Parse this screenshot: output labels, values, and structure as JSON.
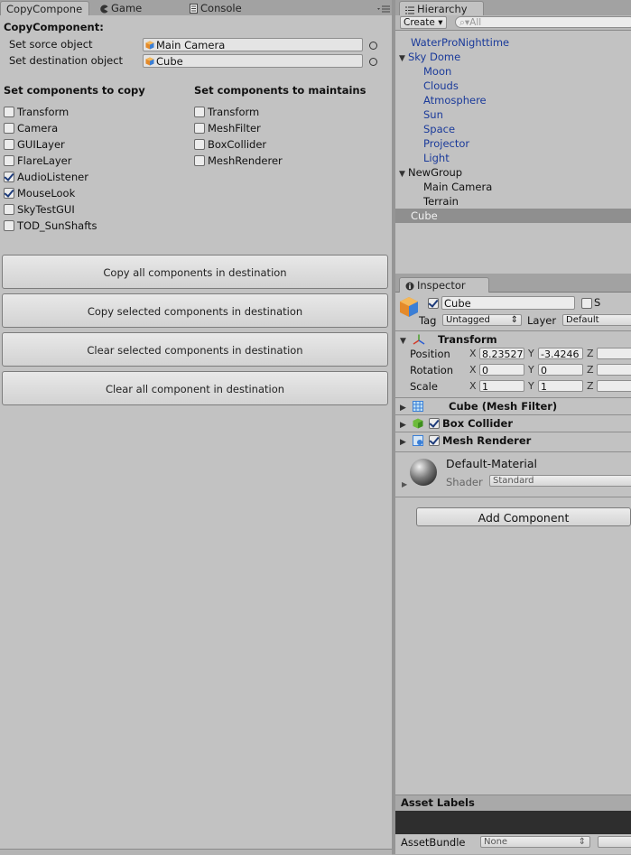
{
  "left_tabs": [
    {
      "label": "CopyCompone",
      "icon": "none",
      "active": true
    },
    {
      "label": "Game",
      "icon": "pacman-icon",
      "active": false
    },
    {
      "label": "Console",
      "icon": "console-icon",
      "active": false
    }
  ],
  "copy": {
    "header": "CopyComponent:",
    "source_label": "Set sorce object",
    "source_value": "Main Camera",
    "dest_label": "Set destination object",
    "dest_value": "Cube",
    "copy_header": "Set components to copy",
    "maintain_header": "Set components to maintains",
    "copy_list": [
      {
        "label": "Transform",
        "checked": false
      },
      {
        "label": "Camera",
        "checked": false
      },
      {
        "label": "GUILayer",
        "checked": false
      },
      {
        "label": "FlareLayer",
        "checked": false
      },
      {
        "label": "AudioListener",
        "checked": true
      },
      {
        "label": "MouseLook",
        "checked": true
      },
      {
        "label": "SkyTestGUI",
        "checked": false
      },
      {
        "label": "TOD_SunShafts",
        "checked": false
      }
    ],
    "maintain_list": [
      {
        "label": "Transform",
        "checked": false
      },
      {
        "label": "MeshFilter",
        "checked": false
      },
      {
        "label": "BoxCollider",
        "checked": false
      },
      {
        "label": "MeshRenderer",
        "checked": false
      }
    ],
    "buttons": [
      "Copy all components in destination",
      "Copy selected components in destination",
      "Clear selected components in destination",
      "Clear all component in destination"
    ]
  },
  "hierarchy": {
    "tab": "Hierarchy",
    "create": "Create",
    "search_placeholder": "All",
    "items": [
      {
        "label": "WaterProNighttime",
        "indent": 1,
        "color": "blue",
        "expand": ""
      },
      {
        "label": "Sky Dome",
        "indent": 0,
        "color": "blue",
        "expand": "open"
      },
      {
        "label": "Moon",
        "indent": 2,
        "color": "blue",
        "expand": ""
      },
      {
        "label": "Clouds",
        "indent": 2,
        "color": "blue",
        "expand": ""
      },
      {
        "label": "Atmosphere",
        "indent": 2,
        "color": "blue",
        "expand": ""
      },
      {
        "label": "Sun",
        "indent": 2,
        "color": "blue",
        "expand": ""
      },
      {
        "label": "Space",
        "indent": 2,
        "color": "blue",
        "expand": ""
      },
      {
        "label": "Projector",
        "indent": 2,
        "color": "blue",
        "expand": ""
      },
      {
        "label": "Light",
        "indent": 2,
        "color": "blue",
        "expand": ""
      },
      {
        "label": "NewGroup",
        "indent": 0,
        "color": "black",
        "expand": "open"
      },
      {
        "label": "Main Camera",
        "indent": 2,
        "color": "black",
        "expand": ""
      },
      {
        "label": "Terrain",
        "indent": 2,
        "color": "black",
        "expand": ""
      },
      {
        "label": "Cube",
        "indent": 1,
        "color": "white",
        "expand": "",
        "selected": true
      }
    ]
  },
  "inspector": {
    "tab": "Inspector",
    "object_name": "Cube",
    "static_label": "S",
    "tag_label": "Tag",
    "tag_value": "Untagged",
    "layer_label": "Layer",
    "layer_value": "Default",
    "transform_title": "Transform",
    "position_label": "Position",
    "rotation_label": "Rotation",
    "scale_label": "Scale",
    "x": "X",
    "y": "Y",
    "z": "Z",
    "position": {
      "x": "8.23527",
      "y": "-3.4246",
      "z": ""
    },
    "rotation": {
      "x": "0",
      "y": "0",
      "z": ""
    },
    "scale": {
      "x": "1",
      "y": "1",
      "z": ""
    },
    "mesh_filter": "Cube (Mesh Filter)",
    "box_collider": "Box Collider",
    "mesh_renderer": "Mesh Renderer",
    "material_name": "Default-Material",
    "shader_label": "Shader",
    "shader_value": "Standard",
    "add_component": "Add Component",
    "asset_labels": "Asset Labels",
    "asset_bundle_label": "AssetBundle",
    "asset_bundle_value": "None"
  }
}
